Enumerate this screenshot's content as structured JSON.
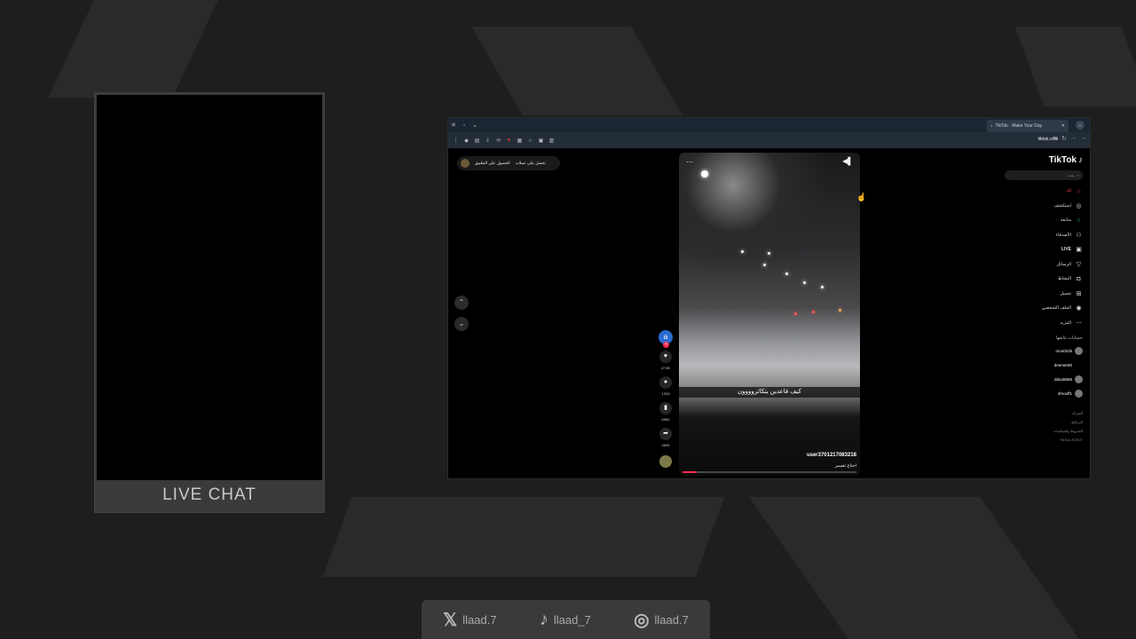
{
  "chat": {
    "title": "LIVE CHAT"
  },
  "browser": {
    "tab_title": "TikTok - Make Your Day",
    "url": "tiktok.com"
  },
  "page": {
    "top_buttons": [
      "الحصول على التطبيق",
      "تحصل على عملات"
    ],
    "video": {
      "caption": "كيف قاعدين يتكاثروووون",
      "author": "user3701217083218",
      "description": "اجتاع تفسير",
      "progress_percent": 8
    },
    "actions": {
      "avatar_letter": "a",
      "likes": "47.5K",
      "comments": "1333",
      "saves": "6960",
      "shares": "4606"
    },
    "sidebar": {
      "logo": "TikTok",
      "search_placeholder": "بحث",
      "nav": [
        {
          "label": "لك",
          "icon": "home-icon"
        },
        {
          "label": "استكشف",
          "icon": "compass-icon"
        },
        {
          "label": "متابعة",
          "icon": "following-icon"
        },
        {
          "label": "الأصدقاء",
          "icon": "friends-icon"
        },
        {
          "label": "LIVE",
          "icon": "live-icon"
        },
        {
          "label": "الرسائل",
          "icon": "messages-icon"
        },
        {
          "label": "النشاط",
          "icon": "activity-icon"
        },
        {
          "label": "تحميل",
          "icon": "upload-icon"
        },
        {
          "label": "الملف الشخصي",
          "icon": "profile-icon"
        },
        {
          "label": "المزيد",
          "icon": "more-icon"
        }
      ],
      "following_title": "حسابات تتابعها",
      "following": [
        {
          "name": "moo022k"
        },
        {
          "name": "deemer90"
        },
        {
          "name": "ddoo5555"
        },
        {
          "name": "shrooff1"
        }
      ],
      "footer": [
        "الشركة",
        "البرنامج",
        "الشروط والسياسات",
        "© 2025 TikTok"
      ]
    }
  },
  "social": [
    {
      "icon": "x-icon",
      "handle": "llaad.7"
    },
    {
      "icon": "tiktok-icon",
      "handle": "llaad_7"
    },
    {
      "icon": "instagram-icon",
      "handle": "llaad.7"
    }
  ]
}
